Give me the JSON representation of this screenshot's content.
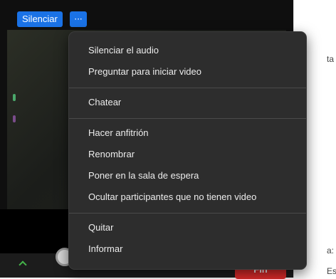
{
  "controls": {
    "mute_label": "Silenciar",
    "more_label": "···"
  },
  "menu": {
    "groups": [
      [
        "Silenciar el audio",
        "Preguntar para iniciar video"
      ],
      [
        "Chatear"
      ],
      [
        "Hacer anfitrión",
        "Renombrar",
        "Poner en la sala de espera",
        "Ocultar participantes que no tienen video"
      ],
      [
        "Quitar",
        "Informar"
      ]
    ]
  },
  "side_panel": {
    "fragment_top": "ta",
    "fragment_mid": "a:",
    "fragment_bottom": "Escri"
  },
  "toolbar": {
    "end_label": "Fin"
  },
  "colors": {
    "accent_blue": "#1a72e6",
    "end_red": "#de2b2b",
    "menu_bg": "#2d2d2d"
  }
}
